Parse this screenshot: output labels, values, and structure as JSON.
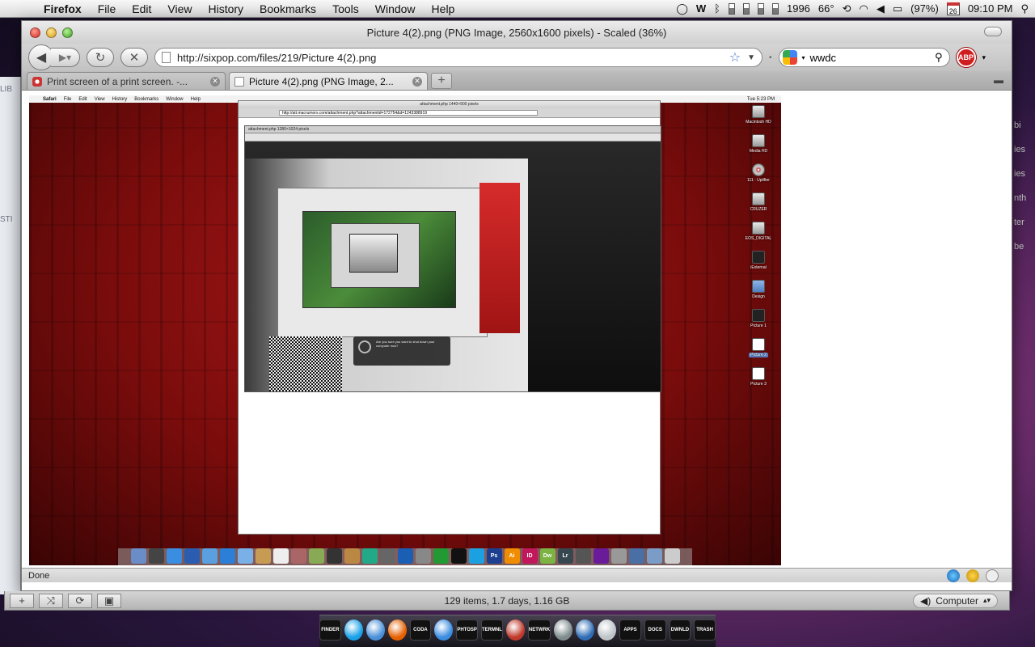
{
  "menubar": {
    "app": "Firefox",
    "menus": [
      "File",
      "Edit",
      "View",
      "History",
      "Bookmarks",
      "Tools",
      "Window",
      "Help"
    ],
    "year": "1996",
    "temperature": "66°",
    "battery": "(97%)",
    "calendar_day": "26",
    "clock": "09:10 PM"
  },
  "window": {
    "title": "Picture 4(2).png (PNG Image, 2560x1600 pixels) - Scaled (36%)",
    "url": "http://sixpop.com/files/219/Picture 4(2).png",
    "search_value": "wwdc",
    "abp_label": "ABP",
    "tabs": [
      {
        "label": "Print screen of a print screen. -..."
      },
      {
        "label": "Picture 4(2).png (PNG Image, 2..."
      }
    ],
    "status": "Done"
  },
  "shot": {
    "menus": [
      "Safari",
      "File",
      "Edit",
      "View",
      "History",
      "Bookmarks",
      "Window",
      "Help"
    ],
    "clock": "Tue 5:23 PM",
    "window_title": "attachment.php 1440×900 pixels",
    "window_url": "http://att.macrumors.com/attachment.php?attachmentid=172754&d=1243388919",
    "nested_title": "attachment.php 1280×1024 pixels",
    "dialog_text": "Are you sure you want to shut down your computer now?",
    "desktop_icons": [
      {
        "label": "Macintosh HD",
        "kind": "drive"
      },
      {
        "label": "Media HD",
        "kind": "drive"
      },
      {
        "label": "111 - Uplifter",
        "kind": "cd"
      },
      {
        "label": "CRUZER",
        "kind": "drive"
      },
      {
        "label": "EOS_DIGITAL",
        "kind": "drive"
      },
      {
        "label": "iExternal",
        "kind": "dark"
      },
      {
        "label": "Design",
        "kind": "folder"
      },
      {
        "label": "Picture 1",
        "kind": "dark"
      },
      {
        "label": "Picture 2",
        "kind": "pic"
      },
      {
        "label": "Picture 3",
        "kind": "pic"
      }
    ],
    "dock_labels": [
      "Ps",
      "Ai",
      "ID",
      "Dw",
      "Lr"
    ]
  },
  "finder": {
    "status": "129 items, 1.7 days, 1.16 GB",
    "location": "Computer"
  },
  "behind": {
    "left_labels": [
      "LIB",
      "STI"
    ],
    "right_labels": [
      "bi",
      "ies",
      "ies",
      "nth",
      "ter",
      "be"
    ]
  },
  "dock": {
    "items": [
      {
        "label": "FINDER",
        "kind": "sq"
      },
      {
        "label": "",
        "kind": "skype",
        "color": "#19a0e8"
      },
      {
        "label": "",
        "kind": "itunes",
        "color": "#4a90d9"
      },
      {
        "label": "",
        "kind": "firefox",
        "color": "#e66000"
      },
      {
        "label": "CODA",
        "kind": "sq"
      },
      {
        "label": "",
        "kind": "safari",
        "color": "#3a8de0"
      },
      {
        "label": "PHTOSP",
        "kind": "sq"
      },
      {
        "label": "TERMNL",
        "kind": "sq"
      },
      {
        "label": "",
        "kind": "app",
        "color": "#c0392b"
      },
      {
        "label": "NETWRK",
        "kind": "sq"
      },
      {
        "label": "",
        "kind": "app",
        "color": "#7f8c8d"
      },
      {
        "label": "",
        "kind": "app",
        "color": "#2f6db5"
      },
      {
        "label": "",
        "kind": "app",
        "color": "#bdc3c7"
      },
      {
        "label": "APPS",
        "kind": "sq"
      },
      {
        "label": "DOCS",
        "kind": "sq"
      },
      {
        "label": "DWNLD",
        "kind": "sq"
      },
      {
        "label": "TRASH",
        "kind": "sq"
      }
    ]
  }
}
